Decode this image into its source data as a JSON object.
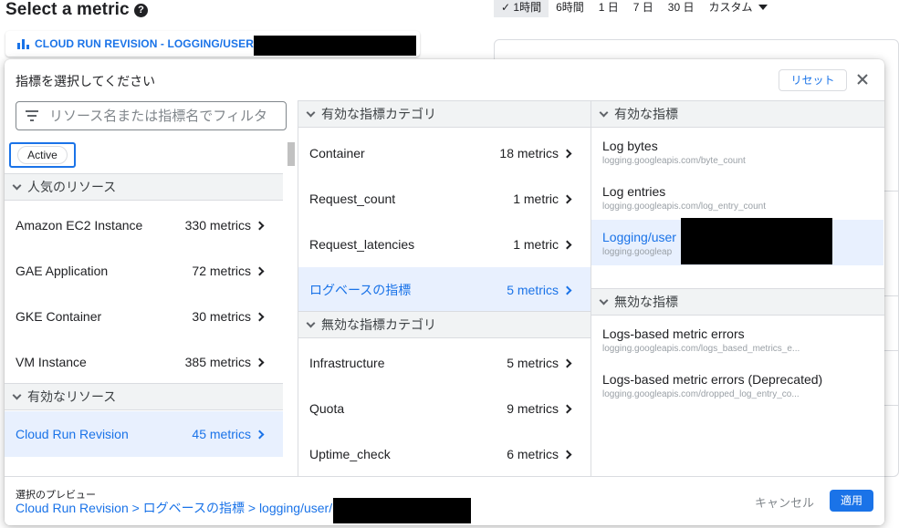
{
  "page": {
    "title": "Select a metric",
    "time_options": [
      "✓ 1時間",
      "6時間",
      "1 日",
      "7 日",
      "30 日",
      "カスタム"
    ],
    "selected_chip": "CLOUD RUN REVISION - LOGGING/USER/"
  },
  "dialog": {
    "title": "指標を選択してください",
    "reset_label": "リセット",
    "filter_placeholder": "リソース名または指標名でフィルタ",
    "active_chip": "Active",
    "col1": {
      "popular_header": "人気のリソース",
      "popular": [
        {
          "name": "Amazon EC2 Instance",
          "count": "330 metrics"
        },
        {
          "name": "GAE Application",
          "count": "72 metrics"
        },
        {
          "name": "GKE Container",
          "count": "30 metrics"
        },
        {
          "name": "VM Instance",
          "count": "385 metrics"
        }
      ],
      "active_header": "有効なリソース",
      "active": [
        {
          "name": "Cloud Run Revision",
          "count": "45 metrics"
        }
      ]
    },
    "col2": {
      "active_header": "有効な指標カテゴリ",
      "active": [
        {
          "name": "Container",
          "count": "18 metrics"
        },
        {
          "name": "Request_count",
          "count": "1 metric"
        },
        {
          "name": "Request_latencies",
          "count": "1 metric"
        },
        {
          "name": "ログベースの指標",
          "count": "5 metrics"
        }
      ],
      "inactive_header": "無効な指標カテゴリ",
      "inactive": [
        {
          "name": "Infrastructure",
          "count": "5 metrics"
        },
        {
          "name": "Quota",
          "count": "9 metrics"
        },
        {
          "name": "Uptime_check",
          "count": "6 metrics"
        }
      ]
    },
    "col3": {
      "active_header": "有効な指標",
      "active": [
        {
          "name": "Log bytes",
          "sub": "logging.googleapis.com/byte_count"
        },
        {
          "name": "Log entries",
          "sub": "logging.googleapis.com/log_entry_count"
        },
        {
          "name": "Logging/user",
          "sub": "logging.googleap"
        }
      ],
      "inactive_header": "無効な指標",
      "inactive": [
        {
          "name": "Logs-based metric errors",
          "sub": "logging.googleapis.com/logs_based_metrics_e..."
        },
        {
          "name": "Logs-based metric errors (Deprecated)",
          "sub": "logging.googleapis.com/dropped_log_entry_co..."
        }
      ]
    },
    "footer": {
      "preview_label": "選択のプレビュー",
      "preview_path": "Cloud Run Revision > ログベースの指標 > logging/user/",
      "cancel_label": "キャンセル",
      "apply_label": "適用"
    }
  },
  "colors": {
    "accent": "#1a73e8",
    "selected_bg": "#e8f0fe",
    "header_bg": "#f1f3f4",
    "redaction": "#000000"
  }
}
